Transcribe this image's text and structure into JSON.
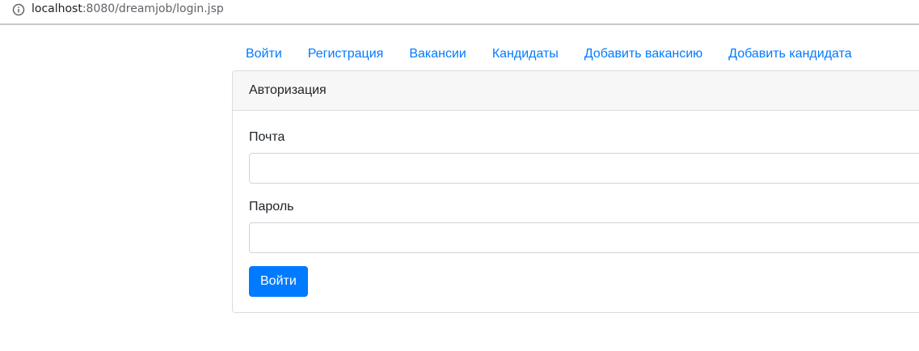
{
  "browser": {
    "url_host": "localhost",
    "url_path": ":8080/dreamjob/login.jsp"
  },
  "nav": {
    "items": [
      {
        "label": "Войти"
      },
      {
        "label": "Регистрация"
      },
      {
        "label": "Вакансии"
      },
      {
        "label": "Кандидаты"
      },
      {
        "label": "Добавить вакансию"
      },
      {
        "label": "Добавить кандидата"
      }
    ]
  },
  "card": {
    "title": "Авторизация",
    "email_label": "Почта",
    "email_value": "",
    "password_label": "Пароль",
    "password_value": "",
    "submit_label": "Войти"
  },
  "colors": {
    "link": "#007bff",
    "primary_button": "#007bff",
    "card_header_bg": "#f7f7f7"
  }
}
